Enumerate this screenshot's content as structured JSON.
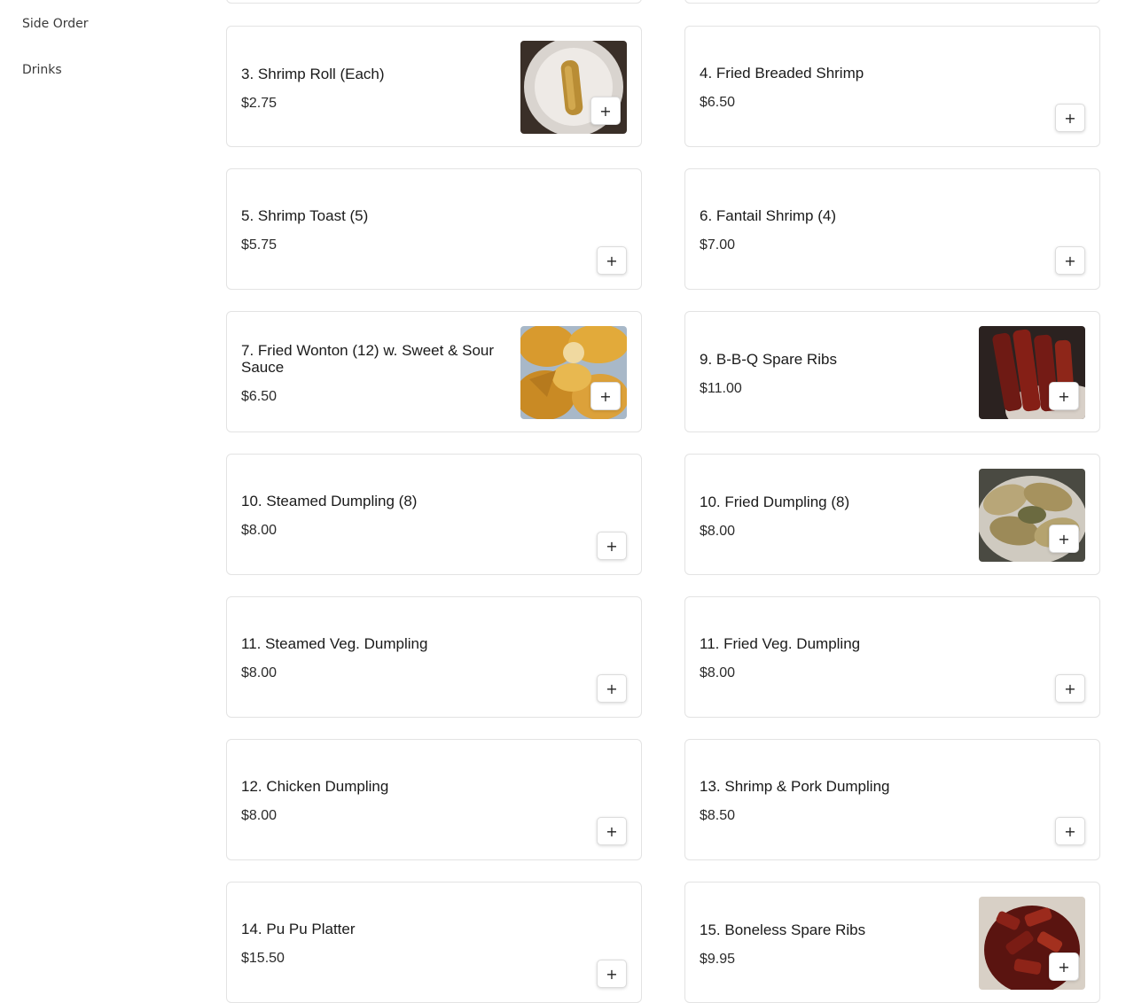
{
  "sidebar": {
    "items": [
      {
        "label": "Side Order"
      },
      {
        "label": "Drinks"
      }
    ]
  },
  "menu": {
    "add_label": "+",
    "items": [
      {
        "name": "3. Shrimp Roll (Each)",
        "price": "$2.75",
        "image": "shrimp-roll-photo"
      },
      {
        "name": "4. Fried Breaded Shrimp",
        "price": "$6.50"
      },
      {
        "name": "5. Shrimp Toast (5)",
        "price": "$5.75"
      },
      {
        "name": "6. Fantail Shrimp (4)",
        "price": "$7.00"
      },
      {
        "name": "7. Fried Wonton (12) w. Sweet & Sour Sauce",
        "price": "$6.50",
        "image": "fried-wonton-photo"
      },
      {
        "name": "9. B-B-Q Spare Ribs",
        "price": "$11.00",
        "image": "spare-ribs-photo"
      },
      {
        "name": "10. Steamed Dumpling (8)",
        "price": "$8.00"
      },
      {
        "name": "10. Fried Dumpling (8)",
        "price": "$8.00",
        "image": "fried-dumpling-photo"
      },
      {
        "name": "11. Steamed Veg. Dumpling",
        "price": "$8.00"
      },
      {
        "name": "11. Fried Veg. Dumpling",
        "price": "$8.00"
      },
      {
        "name": "12. Chicken Dumpling",
        "price": "$8.00"
      },
      {
        "name": "13. Shrimp & Pork Dumpling",
        "price": "$8.50"
      },
      {
        "name": "14. Pu Pu Platter",
        "price": "$15.50"
      },
      {
        "name": "15. Boneless Spare Ribs",
        "price": "$9.95",
        "image": "boneless-ribs-photo"
      }
    ]
  }
}
